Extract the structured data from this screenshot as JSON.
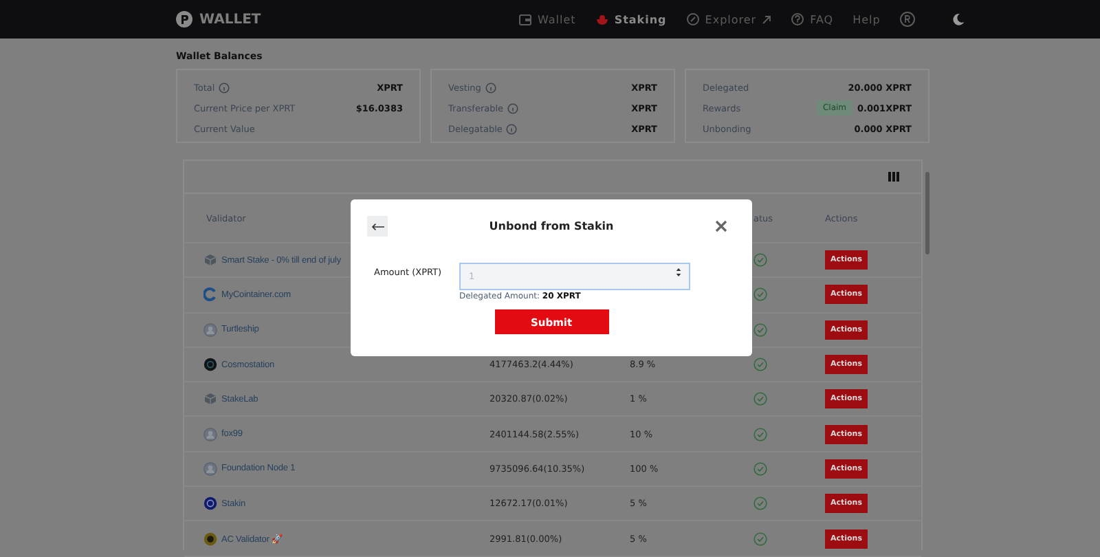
{
  "nav": {
    "brand": "WALLET",
    "items": [
      {
        "label": "Wallet",
        "selected": false,
        "external": false
      },
      {
        "label": "Staking",
        "selected": true,
        "external": false
      },
      {
        "label": "Explorer",
        "selected": false,
        "external": true
      },
      {
        "label": "FAQ",
        "selected": false,
        "external": false
      },
      {
        "label": "Help",
        "selected": false,
        "external": false
      }
    ]
  },
  "balances": {
    "title": "Wallet Balances",
    "cards": [
      [
        {
          "label": "Total",
          "info": true,
          "value": "XPRT"
        },
        {
          "label": "Current Price per XPRT",
          "info": false,
          "value": "$16.0383"
        },
        {
          "label": "Current Value",
          "info": false
        }
      ],
      [
        {
          "label": "Vesting",
          "info": true,
          "value": "XPRT"
        },
        {
          "label": "Transferable",
          "info": true,
          "value": "XPRT"
        },
        {
          "label": "Delegatable",
          "info": true,
          "value": "XPRT"
        }
      ],
      [
        {
          "label": "Delegated",
          "info": false,
          "value": "20.000 XPRT"
        },
        {
          "label": "Rewards",
          "info": false,
          "badge": "Claim",
          "value": "0.001XPRT"
        },
        {
          "label": "Unbonding",
          "info": false,
          "value": "0.000 XPRT"
        }
      ]
    ]
  },
  "table": {
    "columns": [
      "Validator",
      "atus",
      "Actions"
    ],
    "rows": [
      {
        "validator": "Smart Stake - 0% till end of july",
        "active": true,
        "action": "Actions"
      },
      {
        "validator": "MyCointainer.com",
        "active": true,
        "action": "Actions"
      },
      {
        "validator": "Turtleship",
        "active": true,
        "action": "Actions"
      },
      {
        "validator": "Cosmostation",
        "voting_power": "4177463.2(4.44%)",
        "commission": "8.9 %",
        "active": true,
        "action": "Actions"
      },
      {
        "validator": "StakeLab",
        "voting_power": "20320.87(0.02%)",
        "commission": "1 %",
        "active": true,
        "action": "Actions"
      },
      {
        "validator": "fox99",
        "voting_power": "2401144.58(2.55%)",
        "commission": "10 %",
        "active": true,
        "action": "Actions"
      },
      {
        "validator": "Foundation Node 1",
        "voting_power": "9735096.64(10.35%)",
        "commission": "100 %",
        "active": true,
        "action": "Actions"
      },
      {
        "validator": "Stakin",
        "voting_power": "12672.17(0.01%)",
        "commission": "5 %",
        "active": true,
        "action": "Actions"
      },
      {
        "validator": "AC Validator 🚀",
        "voting_power": "2991.81(0.00%)",
        "commission": "5 %",
        "active": true,
        "action": "Actions"
      }
    ]
  },
  "modal": {
    "title": "Unbond from Stakin",
    "field_label": "Amount (XPRT)",
    "placeholder": "1",
    "hint_label": "Delegated Amount:",
    "hint_value": "20 XPRT",
    "submit": "Submit"
  }
}
